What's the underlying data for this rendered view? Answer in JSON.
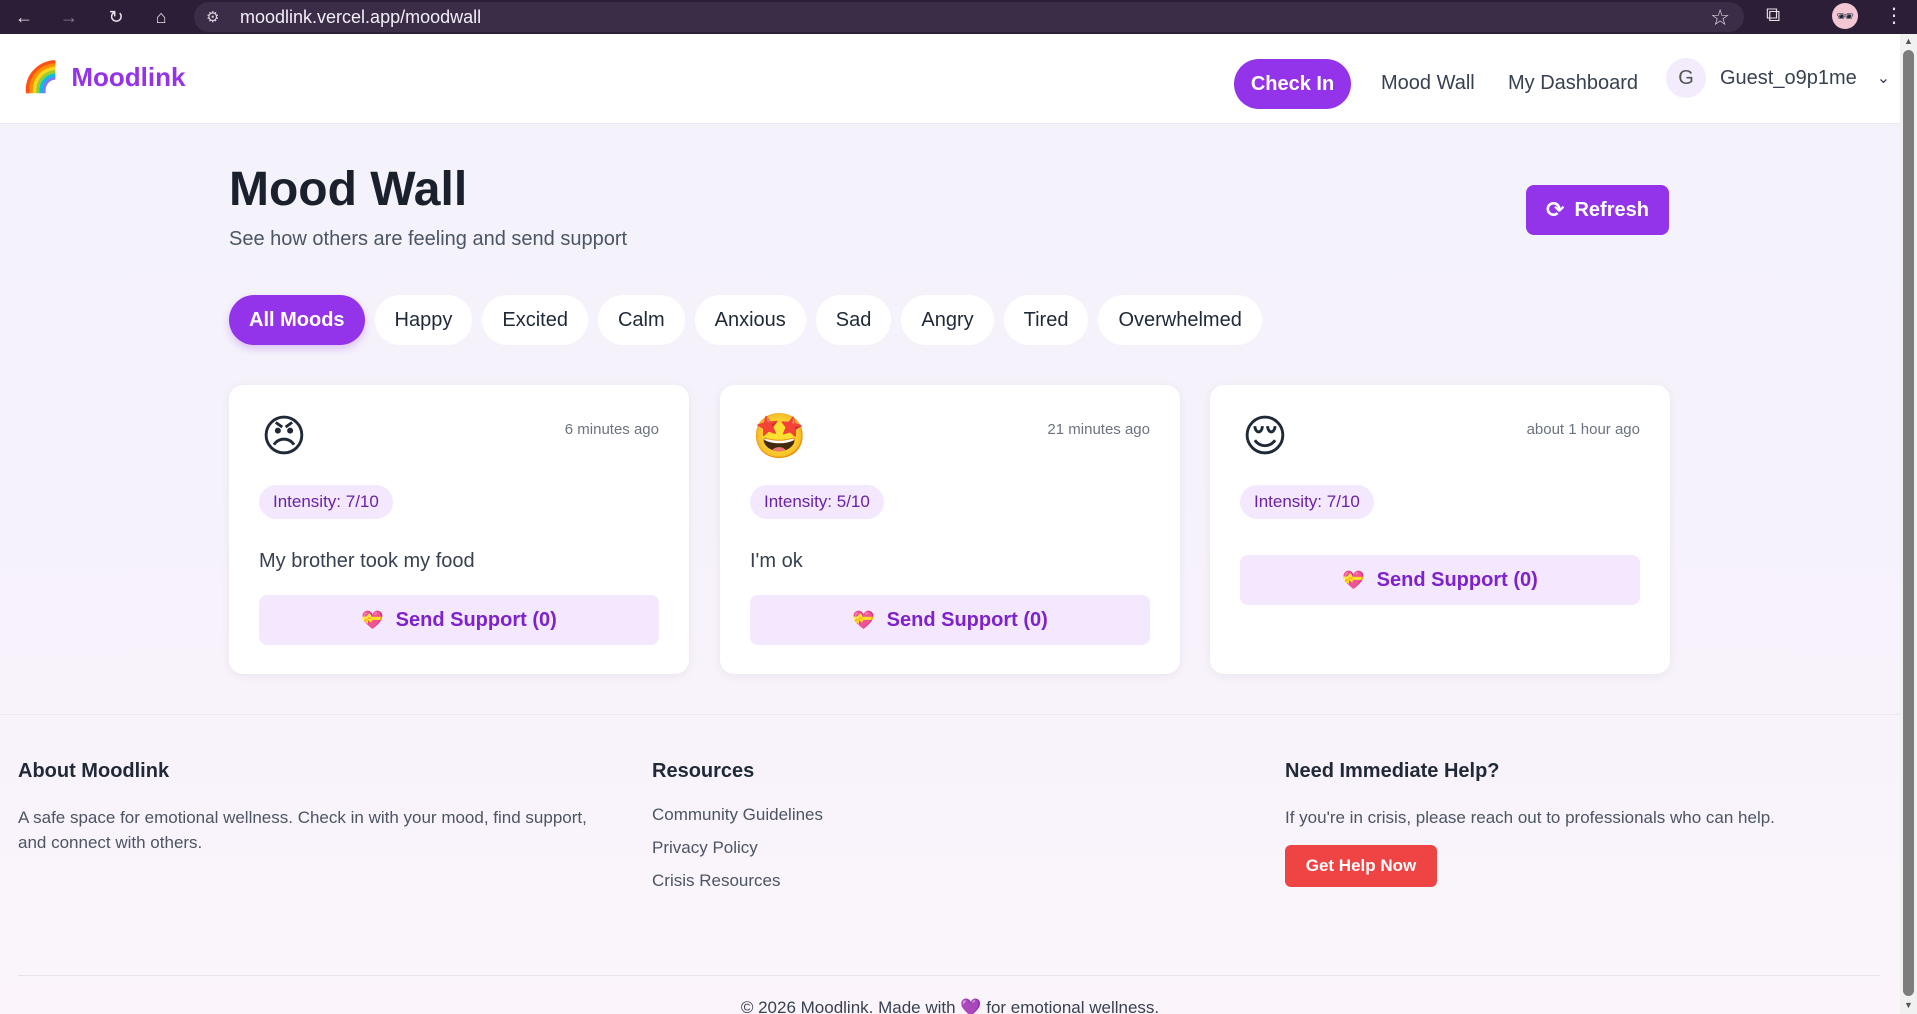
{
  "browser": {
    "url": "moodlink.vercel.app/moodwall"
  },
  "header": {
    "logo_emoji": "🌈",
    "brand": "Moodlink",
    "checkin_label": "Check In",
    "nav": [
      "Mood Wall",
      "My Dashboard"
    ],
    "user_initial": "G",
    "username": "Guest_o9p1me"
  },
  "main": {
    "title": "Mood Wall",
    "subtitle": "See how others are feeling and send support",
    "refresh_label": "Refresh",
    "filters": [
      "All Moods",
      "Happy",
      "Excited",
      "Calm",
      "Anxious",
      "Sad",
      "Angry",
      "Tired",
      "Overwhelmed"
    ],
    "active_filter": "All Moods",
    "cards": [
      {
        "emoji": "😠",
        "time": "6 minutes ago",
        "intensity": "Intensity: 7/10",
        "message": "My brother took my food",
        "support": "Send Support (0)"
      },
      {
        "emoji": "🤩",
        "time": "21 minutes ago",
        "intensity": "Intensity: 5/10",
        "message": "I'm ok",
        "support": "Send Support (0)"
      },
      {
        "emoji": "😌",
        "time": "about 1 hour ago",
        "intensity": "Intensity: 7/10",
        "message": "",
        "support": "Send Support (0)"
      }
    ]
  },
  "footer": {
    "about_title": "About Moodlink",
    "about_text": "A safe space for emotional wellness. Check in with your mood, find support, and connect with others.",
    "resources_title": "Resources",
    "resources": [
      "Community Guidelines",
      "Privacy Policy",
      "Crisis Resources"
    ],
    "help_title": "Need Immediate Help?",
    "help_text": "If you're in crisis, please reach out to professionals who can help.",
    "help_button": "Get Help Now",
    "copyright_pre": "© 2026 Moodlink. Made with",
    "copyright_heart": "💜",
    "copyright_post": "for emotional wellness."
  },
  "colors": {
    "accent": "#9333ea",
    "danger": "#ef4444",
    "support_bg": "#f3e8fd"
  }
}
